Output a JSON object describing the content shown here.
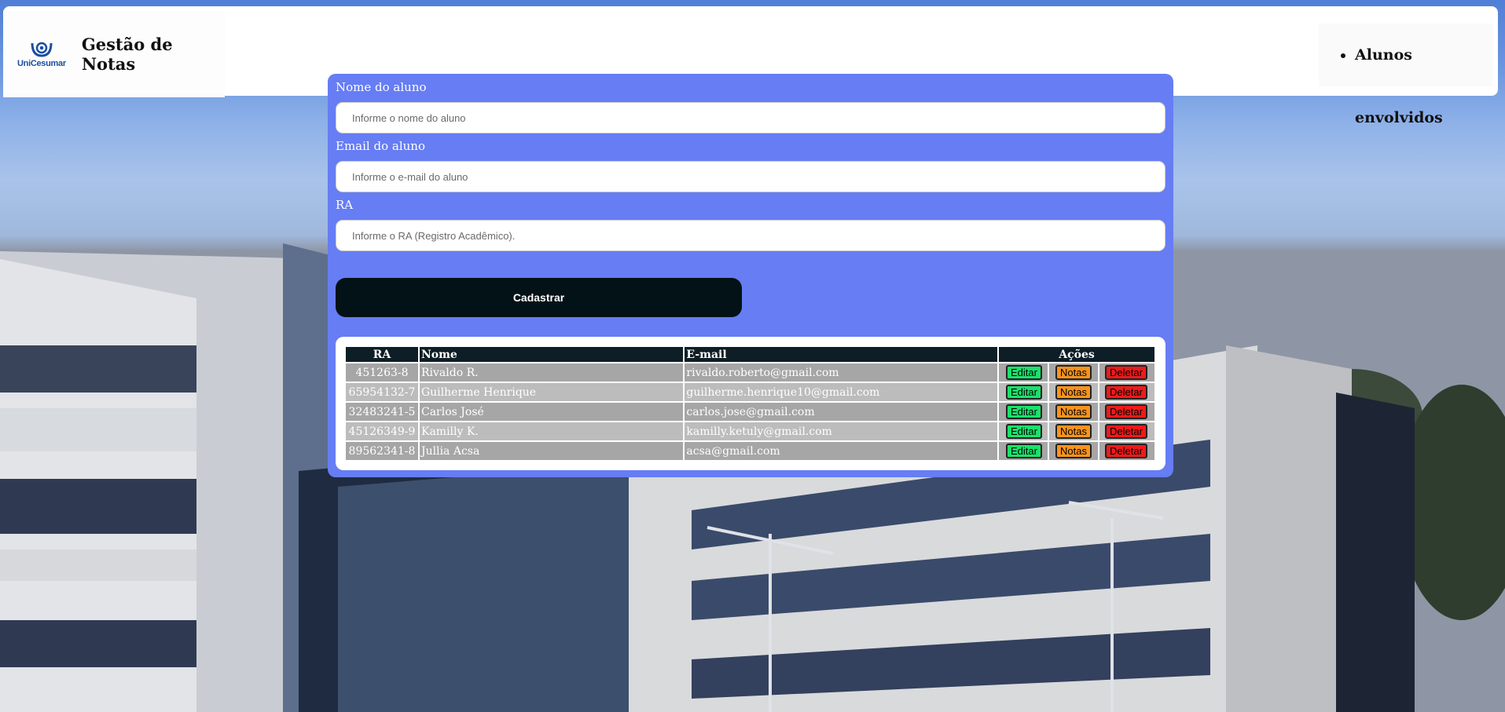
{
  "header": {
    "logo_text": "UniCesumar",
    "title": "Gestão de Notas",
    "nav_items": [
      "Alunos envolvidos"
    ]
  },
  "form": {
    "name_label": "Nome do aluno",
    "name_placeholder": "Informe o nome do aluno",
    "name_value": "",
    "email_label": "Email do aluno",
    "email_placeholder": "Informe o e-mail do aluno",
    "email_value": "",
    "ra_label": "RA",
    "ra_placeholder": "Informe o RA (Registro Acadêmico).",
    "ra_value": "",
    "submit_label": "Cadastrar"
  },
  "table": {
    "headers": [
      "RA",
      "Nome",
      "E-mail",
      "Ações"
    ],
    "actions": [
      "Editar",
      "Notas",
      "Deletar"
    ],
    "rows": [
      {
        "ra": "451263-8",
        "nome": "Rivaldo R.",
        "email": "rivaldo.roberto@gmail.com"
      },
      {
        "ra": "65954132-7",
        "nome": "Guilherme Henrique",
        "email": "guilherme.henrique10@gmail.com"
      },
      {
        "ra": "32483241-5",
        "nome": "Carlos José",
        "email": "carlos.jose@gmail.com"
      },
      {
        "ra": "45126349-9",
        "nome": "Kamilly K.",
        "email": "kamilly.ketuly@gmail.com"
      },
      {
        "ra": "89562341-8",
        "nome": "Jullia Acsa",
        "email": "acsa@gmail.com"
      }
    ]
  },
  "colors": {
    "card": "#667df4",
    "submit": "#031216",
    "table_header": "#0e1e26",
    "edit": "#19e26b",
    "notes": "#f7931e",
    "delete": "#ef1a1a"
  },
  "icons": [
    "unicesumar-logo-icon"
  ]
}
